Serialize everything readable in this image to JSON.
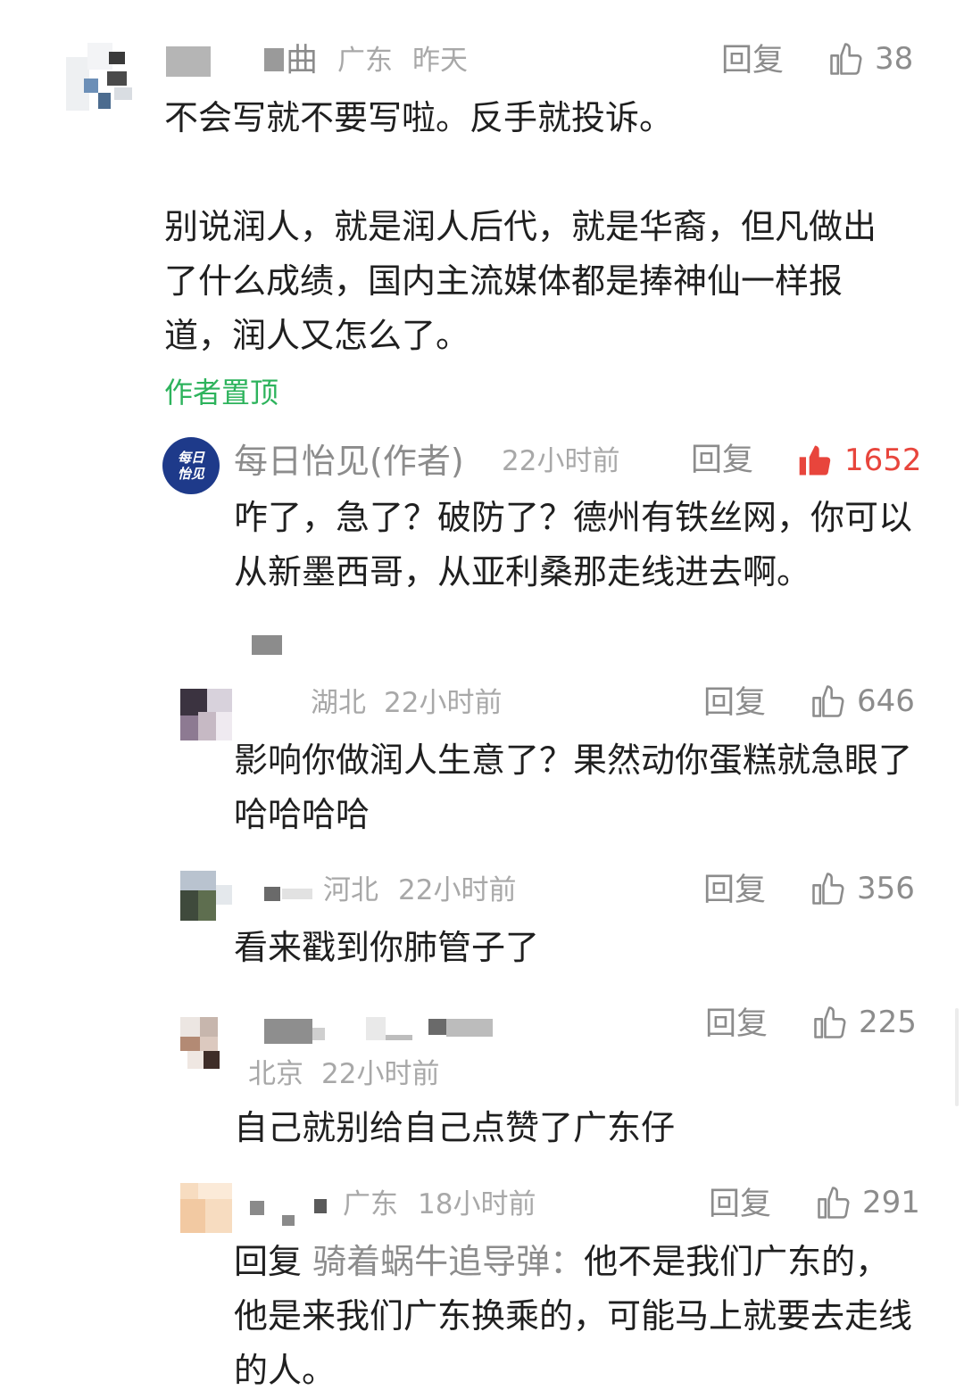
{
  "comments": [
    {
      "name_visible": "曲",
      "location": "广东",
      "time": "昨天",
      "reply_label": "回复",
      "likes": "38",
      "text": "不会写就不要写啦。反手就投诉。\n\n别说润人，就是润人后代，就是华裔，但凡做出了什么成绩，国内主流媒体都是捧神仙一样报道，润人又怎么了。",
      "pinned_label": "作者置顶"
    },
    {
      "author_name": "每日怡见(作者)",
      "avatar_text": "每日\n怡见",
      "time": "22小时前",
      "reply_label": "回复",
      "likes": "1652",
      "liked": true,
      "text": "咋了，急了？破防了？德州有铁丝网，你可以从新墨西哥，从亚利桑那走线进去啊。"
    },
    {
      "location": "湖北",
      "time": "22小时前",
      "reply_label": "回复",
      "likes": "646",
      "text": "影响你做润人生意了？果然动你蛋糕就急眼了哈哈哈哈"
    },
    {
      "location": "河北",
      "time": "22小时前",
      "reply_label": "回复",
      "likes": "356",
      "text": "看来戳到你肺管子了"
    },
    {
      "location": "北京",
      "time": "22小时前",
      "reply_label": "回复",
      "likes": "225",
      "text": "自己就别给自己点赞了广东仔"
    },
    {
      "location": "广东",
      "time": "18小时前",
      "reply_label": "回复",
      "likes": "291",
      "reply_prefix": "回复",
      "reply_target": "骑着蜗牛追导弹：",
      "text": "他不是我们广东的，他是来我们广东换乘的，可能马上就要去走线的人。"
    }
  ],
  "colors": {
    "pinned": "#2db35c",
    "liked": "#e8453c",
    "meta": "#a8a8a8",
    "action": "#8c8c8c",
    "author_badge": "#1e3a8a"
  },
  "icons": {
    "like": "thumbs-up-outline-icon",
    "liked": "thumbs-up-filled-icon"
  }
}
